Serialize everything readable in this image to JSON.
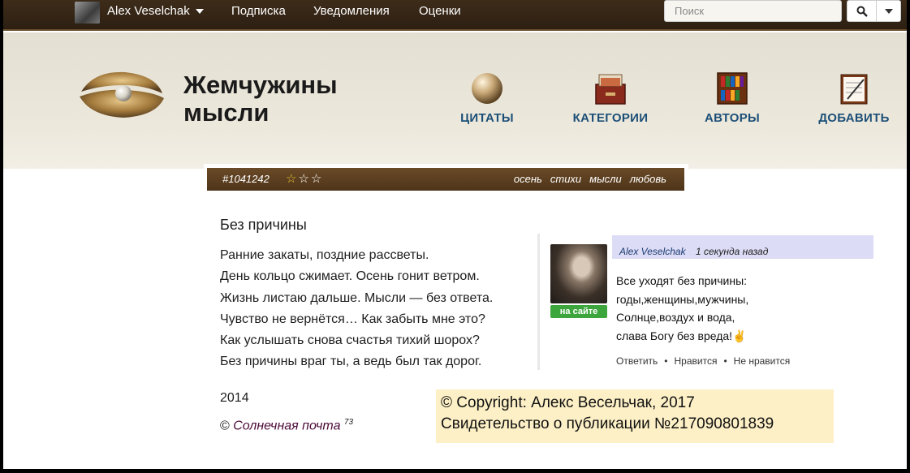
{
  "topbar": {
    "user_name": "Alex Veselchak",
    "nav": [
      "Подписка",
      "Уведомления",
      "Оценки"
    ],
    "search_placeholder": "Поиск"
  },
  "header": {
    "logo_line1": "Жемчужины",
    "logo_line2": "мысли",
    "menu": [
      {
        "label": "ЦИТАТЫ",
        "icon": "pearl-icon"
      },
      {
        "label": "КАТЕГОРИИ",
        "icon": "card-box-icon"
      },
      {
        "label": "АВТОРЫ",
        "icon": "bookshelf-icon"
      },
      {
        "label": "ДОБАВИТЬ",
        "icon": "notepad-icon"
      }
    ]
  },
  "quote_bar": {
    "id": "#1041242",
    "rating_filled": 1,
    "rating_total": 3,
    "tags": [
      "осень",
      "стихи",
      "мысли",
      "любовь"
    ],
    "colors": {
      "bar": "#5c3e20",
      "star": "#e7c036"
    }
  },
  "poem": {
    "title": "Без причины",
    "lines": [
      "Ранние закаты, поздние рассветы.",
      "День кольцо сжимает. Осень гонит ветром.",
      "Жизнь листаю дальше. Мысли — без ответа.",
      "Чувство не вернётся… Как забыть мне это?",
      "Как услышать снова счастья тихий шорох?",
      "Без причины враг ты, а ведь был так дорог."
    ],
    "year": "2014",
    "copyright_sign": "©",
    "author": "Солнечная почта",
    "author_count": "73"
  },
  "comment": {
    "author": "Alex Veselchak",
    "time": "1 секунда назад",
    "status": "на сайте",
    "lines": [
      "Все уходят без причины:",
      "годы,женщины,мужчины,",
      "Солнце,воздух и вода,",
      "слава Богу без вреда!✌"
    ],
    "actions": [
      "Ответить",
      "Нравится",
      "Не нравится"
    ],
    "separator": "•"
  },
  "copyright": {
    "line1": "© Copyright: Алекс Весельчак, 2017",
    "line2": "Свидетельство о публикации №217090801839"
  }
}
